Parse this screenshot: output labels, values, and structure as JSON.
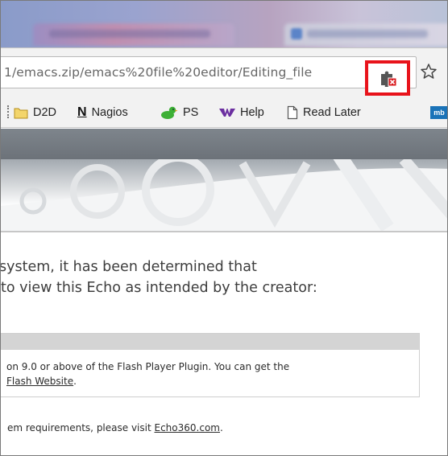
{
  "browser": {
    "address_bar": {
      "url": "1/emacs.zip/emacs%20file%20editor/Editing_file"
    },
    "plugin_blocked_icon": "puzzle-piece-blocked-icon",
    "bookmark_star_icon": "star-icon",
    "highlight_color": "#e8131b"
  },
  "bookmarks": [
    {
      "label": "D2D",
      "icon": "folder-icon"
    },
    {
      "label": "Nagios",
      "icon_text": "N",
      "icon": "nagios-icon"
    },
    {
      "label": "PS",
      "icon": "duck-icon"
    },
    {
      "label": "Help",
      "icon": "purple-w-icon"
    },
    {
      "label": "Read Later",
      "icon": "page-icon"
    },
    {
      "label": "",
      "icon_text": "mb",
      "icon": "mb-icon"
    }
  ],
  "page": {
    "message_line1": "system, it has been determined that",
    "message_line2": "to view this Echo as intended by the creator:",
    "requirement_line1": "on 9.0 or above of the Flash Player Plugin. You can get the",
    "requirement_link": "Flash Website",
    "requirement_link_suffix": ".",
    "footer_prefix": "em requirements, please visit ",
    "footer_link": "Echo360.com",
    "footer_suffix": "."
  }
}
